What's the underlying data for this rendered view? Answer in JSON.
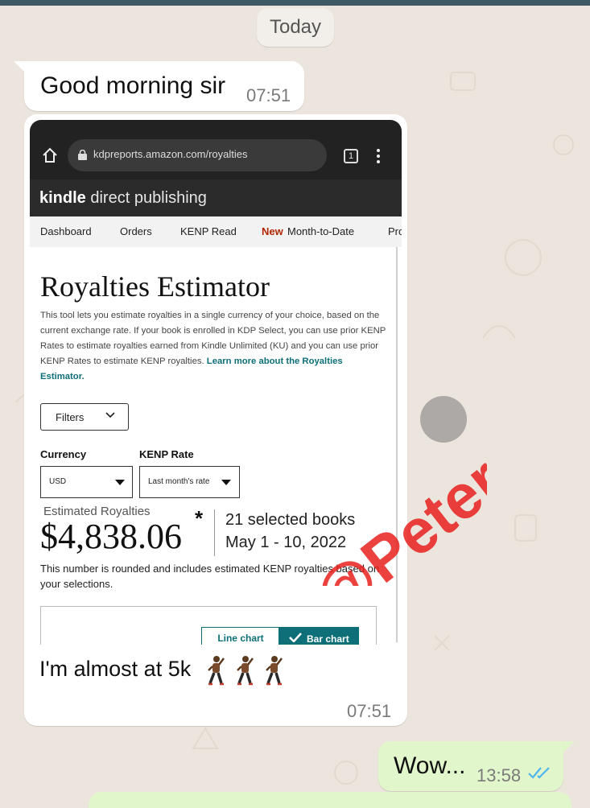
{
  "chat": {
    "date_divider": "Today",
    "messages": [
      {
        "text": "Good morning sir",
        "time": "07:51"
      },
      {
        "caption": "I'm almost at 5k",
        "time": "07:51"
      },
      {
        "text": "Wow...",
        "time": "13:58"
      }
    ]
  },
  "screenshot": {
    "browser": {
      "url": "kdpreports.amazon.com/royalties",
      "tab_count": "1"
    },
    "kdp": {
      "logo_bold": "kindle",
      "logo_rest": " direct publishing",
      "nav": [
        "Dashboard",
        "Orders",
        "KENP Read",
        "New",
        "Month-to-Date",
        "Pro"
      ],
      "title": "Royalties Estimator",
      "description": "This tool lets you estimate royalties in a single currency of your choice, based on the current exchange rate. If your book is enrolled in KDP Select, you can use prior KENP Rates to estimate royalties earned from Kindle Unlimited (KU) and you can use prior KENP Rates to estimate KENP royalties.",
      "learn_more": "Learn more about the Royalties Estimator.",
      "filters_label": "Filters",
      "currency_label": "Currency",
      "currency_value": "USD",
      "kenp_label": "KENP Rate",
      "kenp_value": "Last month's rate",
      "estimated_label": "Estimated Royalties",
      "amount": "$4,838.06",
      "asterisk": "*",
      "selected_books": "21 selected books",
      "date_range": "May 1 - 10, 2022",
      "note": "This number is rounded and includes estimated KENP royalties based on your selections.",
      "line_chart_label": "Line chart",
      "bar_chart_label": "Bar chart"
    },
    "watermark": "@Peter"
  },
  "icons": {
    "home": "home-icon",
    "lock": "lock-icon",
    "menu": "more-vert-icon",
    "check": "check-icon",
    "read_receipt": "double-check-icon",
    "emoji": "man-dancing-emoji"
  },
  "colors": {
    "chat_bg": "#ece5dd",
    "incoming": "#ffffff",
    "outgoing": "#e1f6cb",
    "kdp_teal": "#0e6f78",
    "watermark": "#e8201d",
    "read_tick": "#4fb6ec"
  }
}
